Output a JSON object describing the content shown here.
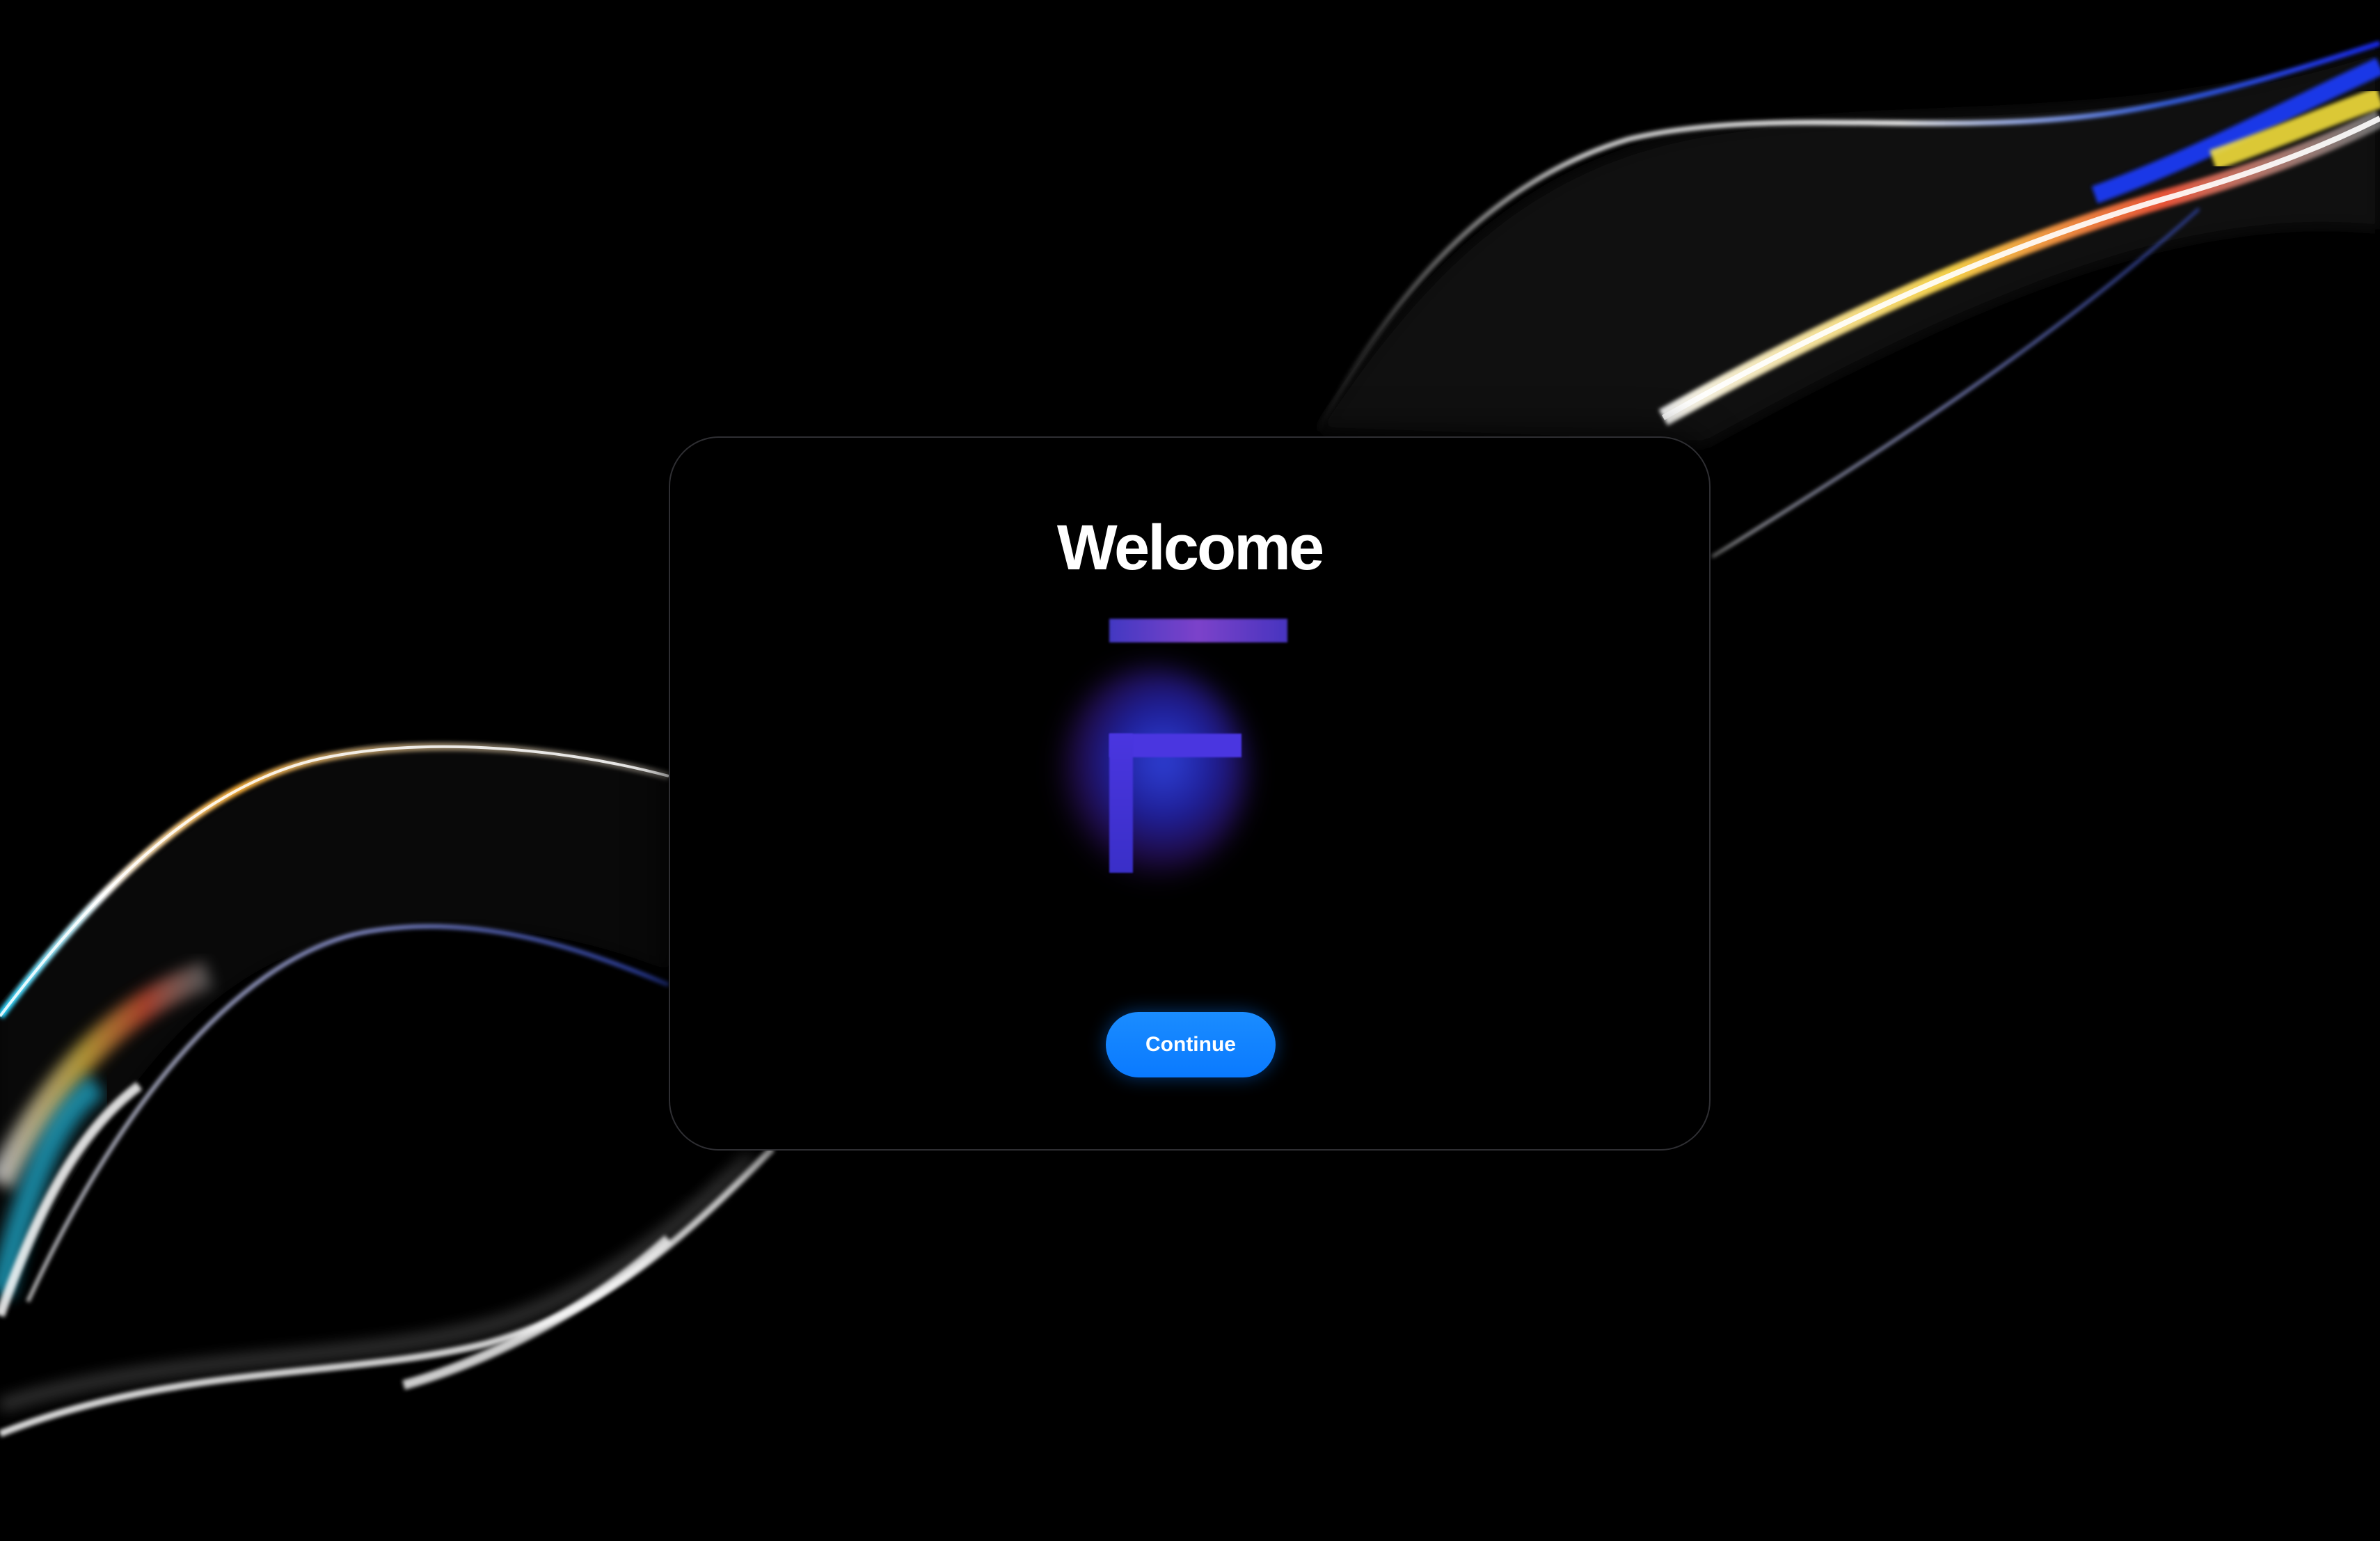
{
  "dialog": {
    "title": "Welcome",
    "logo_icon": "app-logo-icon",
    "continue_label": "Continue"
  },
  "colors": {
    "background": "#000000",
    "dialog_border": "#2e2e32",
    "accent": "#0a7aff",
    "logo_blue": "#4a36e0",
    "logo_purple": "#8a4ae0"
  }
}
